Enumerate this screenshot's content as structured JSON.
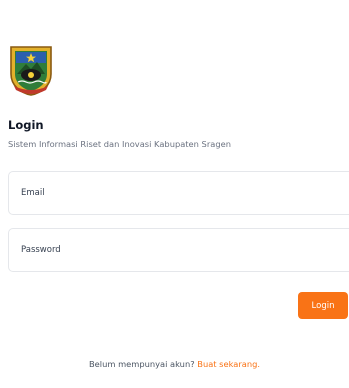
{
  "colors": {
    "accent": "#f97316",
    "title": "#111827",
    "muted": "#6b7280",
    "border": "#e5e7eb"
  },
  "header": {
    "logo_icon": "kabupaten-sragen-coat-of-arms",
    "title": "Login",
    "subtitle": "Sistem Informasi Riset dan Inovasi Kabupaten Sragen"
  },
  "form": {
    "email_placeholder": "Email",
    "password_placeholder": "Password",
    "login_label": "Login"
  },
  "footer": {
    "prompt": "Belum mempunyai akun?",
    "link_label": "Buat sekarang."
  }
}
